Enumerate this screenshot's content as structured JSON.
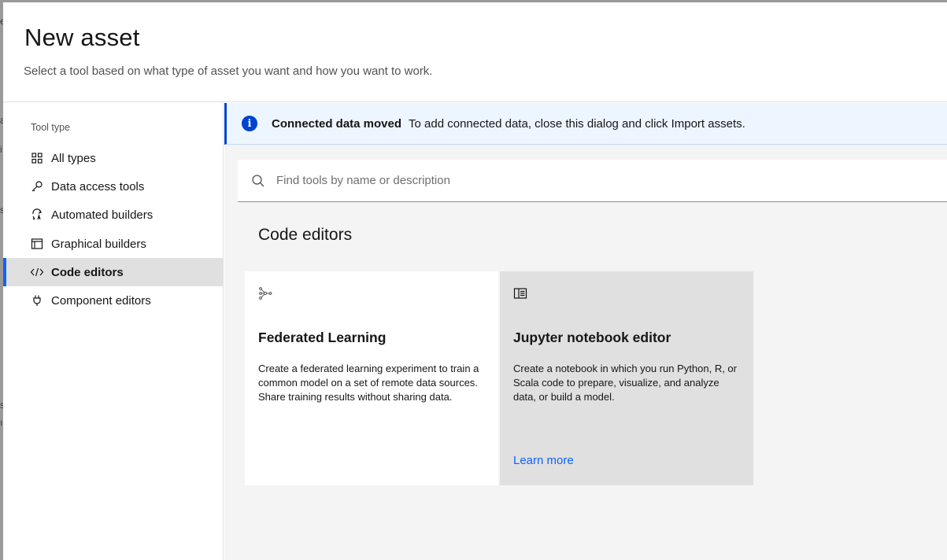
{
  "modal": {
    "title": "New asset",
    "subtitle": "Select a tool based on what type of asset you want and how you want to work."
  },
  "sidebar": {
    "heading": "Tool type",
    "items": [
      {
        "label": "All types",
        "icon": "grid-icon"
      },
      {
        "label": "Data access tools",
        "icon": "key-icon"
      },
      {
        "label": "Automated builders",
        "icon": "automated-builder-icon"
      },
      {
        "label": "Graphical builders",
        "icon": "window-layout-icon"
      },
      {
        "label": "Code editors",
        "icon": "code-icon",
        "active": true
      },
      {
        "label": "Component editors",
        "icon": "plug-icon"
      }
    ]
  },
  "notification": {
    "title": "Connected data moved",
    "message": "To add connected data, close this dialog and click Import assets.",
    "icon": "info-icon"
  },
  "search": {
    "placeholder": "Find tools by name or description",
    "value": ""
  },
  "section": {
    "title": "Code editors"
  },
  "cards": [
    {
      "title": "Federated Learning",
      "description": "Create a federated learning experiment to train a common model on a set of remote data sources. Share training results without sharing data.",
      "icon": "federated-learning-icon"
    },
    {
      "title": "Jupyter notebook editor",
      "description": "Create a notebook in which you run Python, R, or Scala code to prepare, visualize, and analyze data, or build a model.",
      "link": "Learn more",
      "icon": "notebook-icon"
    }
  ],
  "colors": {
    "accent": "#0f62fe",
    "notice_bg": "#edf5ff",
    "active_bg": "#e0e0e0"
  }
}
